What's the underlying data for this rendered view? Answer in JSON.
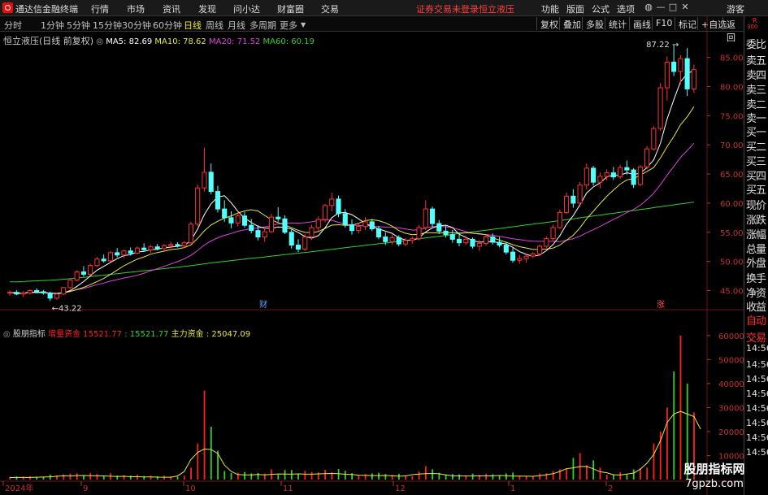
{
  "menubar": {
    "app_name": "通达信金融终端",
    "items": [
      "行情",
      "市场",
      "资讯",
      "发现",
      "问小达",
      "财富圈",
      "交易"
    ],
    "status_login": "证券交易未登录",
    "stock_name": "恒立液压",
    "right_items": [
      "功能",
      "版面",
      "公式",
      "选项"
    ],
    "guest": "游客"
  },
  "toolbar": {
    "periods": [
      "分时",
      "1分钟",
      "5分钟",
      "15分钟",
      "30分钟",
      "60分钟",
      "日线",
      "周线",
      "月线",
      "多周期",
      "更多"
    ],
    "active_period": "日线",
    "right_buttons": [
      "复权",
      "叠加",
      "多股",
      "统计",
      "画线",
      "F10",
      "标记",
      "+自选",
      "返回"
    ]
  },
  "chart_header": {
    "title": "恒立液压(日线 前复权)",
    "ma5": "MA5: 82.69",
    "ma10": "MA10: 78.62",
    "ma20": "MA20: 71.52",
    "ma60": "MA60: 60.19",
    "colors": {
      "ma5": "#ffffff",
      "ma10": "#e8e838",
      "ma20": "#e040e0",
      "ma60": "#30d030"
    }
  },
  "indicator_header": {
    "name": "股朋指标",
    "label1": "增量资金",
    "value1": "15521.77",
    "value2": ": 15521.77",
    "label3": "主力资金",
    "value3": ": 25047.09"
  },
  "annotations": {
    "high_label": "87.22",
    "low_label": "43.22",
    "marker_cai": "财",
    "marker_zhang": "涨"
  },
  "right_panel": {
    "top_label": "R",
    "top_sublabel": "300",
    "items": [
      "委比",
      "卖五",
      "卖四",
      "卖三",
      "卖二",
      "卖一",
      "买一",
      "买二",
      "买三",
      "买四",
      "买五",
      "现价",
      "涨跌",
      "涨幅",
      "总量",
      "外盘",
      "换手",
      "净资",
      "收益",
      "自动",
      "交易",
      "14:56",
      "14:56",
      "14:56",
      "14:56",
      "14:56",
      "14:56",
      "14:56",
      "14:56"
    ]
  },
  "x_axis": {
    "labels": [
      "2024年",
      "9",
      "10",
      "11",
      "12",
      "1",
      "2"
    ]
  },
  "watermark": {
    "title": "股朋指标网",
    "url": "7gpzb.com"
  },
  "chart_data": [
    {
      "type": "candlestick",
      "title": "恒立液压(日线 前复权)",
      "ylim": [
        42,
        89
      ],
      "yticks": [
        45.0,
        50.0,
        55.0,
        60.0,
        65.0,
        70.0,
        75.0,
        80.0,
        85.0
      ],
      "annotations": {
        "high": 87.22,
        "low": 43.22
      },
      "candles": [
        [
          44.6,
          45.0,
          44.1,
          44.7
        ],
        [
          44.7,
          45.1,
          44.2,
          44.4
        ],
        [
          44.4,
          44.9,
          43.9,
          44.6
        ],
        [
          44.6,
          45.2,
          44.3,
          45.0
        ],
        [
          45.0,
          45.4,
          44.5,
          44.8
        ],
        [
          44.8,
          45.1,
          44.3,
          44.6
        ],
        [
          44.6,
          44.8,
          43.2,
          43.7
        ],
        [
          43.7,
          44.6,
          43.4,
          44.4
        ],
        [
          44.4,
          45.6,
          44.2,
          45.5
        ],
        [
          45.5,
          47.0,
          45.3,
          46.8
        ],
        [
          46.8,
          48.5,
          46.6,
          48.2
        ],
        [
          48.2,
          49.2,
          47.4,
          47.8
        ],
        [
          47.8,
          49.6,
          47.6,
          49.3
        ],
        [
          49.3,
          50.8,
          49.0,
          50.4
        ],
        [
          50.4,
          51.2,
          49.8,
          50.1
        ],
        [
          50.1,
          51.8,
          49.9,
          51.5
        ],
        [
          51.5,
          52.3,
          50.7,
          51.1
        ],
        [
          51.1,
          52.0,
          50.6,
          51.8
        ],
        [
          51.8,
          52.4,
          51.0,
          51.4
        ],
        [
          51.4,
          52.6,
          51.2,
          52.3
        ],
        [
          52.3,
          53.1,
          51.8,
          52.0
        ],
        [
          52.0,
          52.8,
          51.5,
          52.5
        ],
        [
          52.5,
          53.0,
          51.9,
          52.2
        ],
        [
          52.2,
          53.0,
          51.8,
          52.7
        ],
        [
          52.7,
          53.4,
          52.3,
          52.9
        ],
        [
          52.9,
          53.3,
          52.4,
          52.7
        ],
        [
          52.7,
          53.5,
          52.3,
          53.2
        ],
        [
          53.2,
          56.8,
          53.0,
          56.4
        ],
        [
          56.4,
          63.2,
          56.0,
          62.6
        ],
        [
          62.6,
          69.5,
          62.0,
          65.3
        ],
        [
          65.3,
          66.8,
          61.5,
          62.0
        ],
        [
          62.0,
          63.0,
          58.4,
          59.0
        ],
        [
          59.0,
          60.5,
          56.8,
          57.5
        ],
        [
          57.5,
          58.6,
          55.7,
          56.6
        ],
        [
          56.6,
          58.6,
          56.0,
          57.8
        ],
        [
          57.8,
          58.5,
          55.8,
          56.2
        ],
        [
          56.2,
          57.3,
          54.8,
          55.3
        ],
        [
          55.3,
          56.2,
          53.6,
          54.2
        ],
        [
          54.2,
          55.8,
          53.4,
          55.1
        ],
        [
          55.1,
          58.2,
          54.9,
          57.6
        ],
        [
          57.6,
          59.3,
          56.8,
          57.3
        ],
        [
          57.3,
          57.9,
          54.7,
          55.0
        ],
        [
          55.0,
          55.6,
          52.2,
          52.8
        ],
        [
          52.8,
          53.8,
          51.6,
          52.1
        ],
        [
          52.1,
          54.7,
          51.8,
          54.2
        ],
        [
          54.2,
          56.3,
          53.7,
          55.8
        ],
        [
          55.8,
          57.7,
          55.1,
          57.2
        ],
        [
          57.2,
          59.9,
          56.7,
          59.6
        ],
        [
          59.6,
          61.8,
          58.6,
          60.7
        ],
        [
          60.7,
          61.3,
          57.6,
          58.2
        ],
        [
          58.2,
          59.0,
          55.8,
          56.3
        ],
        [
          56.3,
          57.2,
          54.6,
          55.3
        ],
        [
          55.3,
          56.5,
          54.8,
          56.0
        ],
        [
          56.0,
          57.6,
          55.4,
          56.8
        ],
        [
          56.8,
          57.3,
          55.2,
          55.6
        ],
        [
          55.6,
          56.1,
          53.8,
          54.2
        ],
        [
          54.2,
          55.0,
          52.8,
          53.4
        ],
        [
          53.4,
          54.6,
          52.9,
          54.1
        ],
        [
          54.1,
          54.5,
          52.6,
          53.0
        ],
        [
          53.0,
          54.0,
          52.6,
          53.6
        ],
        [
          53.6,
          54.3,
          53.0,
          53.9
        ],
        [
          53.9,
          56.2,
          53.6,
          55.8
        ],
        [
          55.8,
          60.5,
          55.4,
          59.0
        ],
        [
          59.0,
          59.4,
          55.9,
          56.5
        ],
        [
          56.5,
          57.1,
          54.7,
          55.2
        ],
        [
          55.2,
          56.3,
          54.1,
          54.6
        ],
        [
          54.6,
          55.4,
          53.2,
          53.8
        ],
        [
          53.8,
          54.9,
          52.6,
          53.2
        ],
        [
          53.2,
          54.3,
          52.8,
          53.8
        ],
        [
          53.8,
          54.1,
          52.2,
          52.6
        ],
        [
          52.6,
          53.7,
          51.8,
          53.1
        ],
        [
          53.1,
          54.6,
          52.7,
          54.2
        ],
        [
          54.2,
          54.8,
          52.9,
          53.3
        ],
        [
          53.3,
          54.2,
          52.4,
          52.8
        ],
        [
          52.8,
          53.3,
          51.2,
          51.6
        ],
        [
          51.6,
          52.3,
          49.8,
          50.2
        ],
        [
          50.2,
          51.1,
          49.6,
          50.5
        ],
        [
          50.5,
          51.2,
          49.8,
          50.9
        ],
        [
          50.9,
          51.6,
          50.6,
          51.3
        ],
        [
          51.3,
          52.9,
          51.0,
          52.6
        ],
        [
          52.6,
          54.3,
          52.3,
          53.9
        ],
        [
          53.9,
          56.3,
          53.6,
          55.8
        ],
        [
          55.8,
          58.9,
          55.6,
          58.4
        ],
        [
          58.4,
          61.8,
          58.1,
          61.2
        ],
        [
          61.2,
          62.4,
          59.2,
          60.0
        ],
        [
          60.0,
          63.6,
          59.7,
          63.1
        ],
        [
          63.1,
          66.8,
          62.4,
          66.0
        ],
        [
          66.0,
          66.4,
          63.0,
          63.6
        ],
        [
          63.6,
          65.3,
          62.5,
          64.6
        ],
        [
          64.6,
          65.8,
          63.9,
          65.2
        ],
        [
          65.2,
          66.2,
          64.0,
          64.5
        ],
        [
          64.5,
          66.6,
          64.2,
          66.1
        ],
        [
          66.1,
          67.3,
          64.9,
          65.7
        ],
        [
          65.7,
          66.0,
          62.6,
          63.2
        ],
        [
          63.2,
          66.5,
          62.9,
          66.2
        ],
        [
          66.2,
          69.8,
          65.8,
          69.3
        ],
        [
          69.3,
          73.2,
          69.0,
          72.8
        ],
        [
          72.8,
          80.6,
          72.4,
          79.8
        ],
        [
          79.8,
          85.2,
          77.6,
          84.2
        ],
        [
          84.2,
          87.2,
          81.8,
          82.6
        ],
        [
          82.6,
          85.4,
          80.4,
          84.8
        ],
        [
          84.8,
          86.6,
          78.4,
          79.6
        ],
        [
          79.6,
          83.8,
          78.9,
          82.9
        ]
      ],
      "ma_series": [
        {
          "name": "MA5",
          "color": "#ffffff",
          "value": 82.69
        },
        {
          "name": "MA10",
          "color": "#e8e838",
          "value": 78.62
        },
        {
          "name": "MA20",
          "color": "#e040e0",
          "value": 71.52
        },
        {
          "name": "MA60",
          "color": "#30d030",
          "value": 60.19
        }
      ]
    },
    {
      "type": "bar",
      "title": "股朋指标",
      "ylim": [
        0,
        65000
      ],
      "yticks": [
        10000,
        20000,
        30000,
        40000,
        50000,
        60000
      ],
      "series": [
        {
          "name": "增量资金",
          "color": "#ff2020",
          "value": 15521.77
        },
        {
          "name": "主力资金",
          "color": "#e8e838",
          "value": 25047.09
        }
      ]
    }
  ]
}
